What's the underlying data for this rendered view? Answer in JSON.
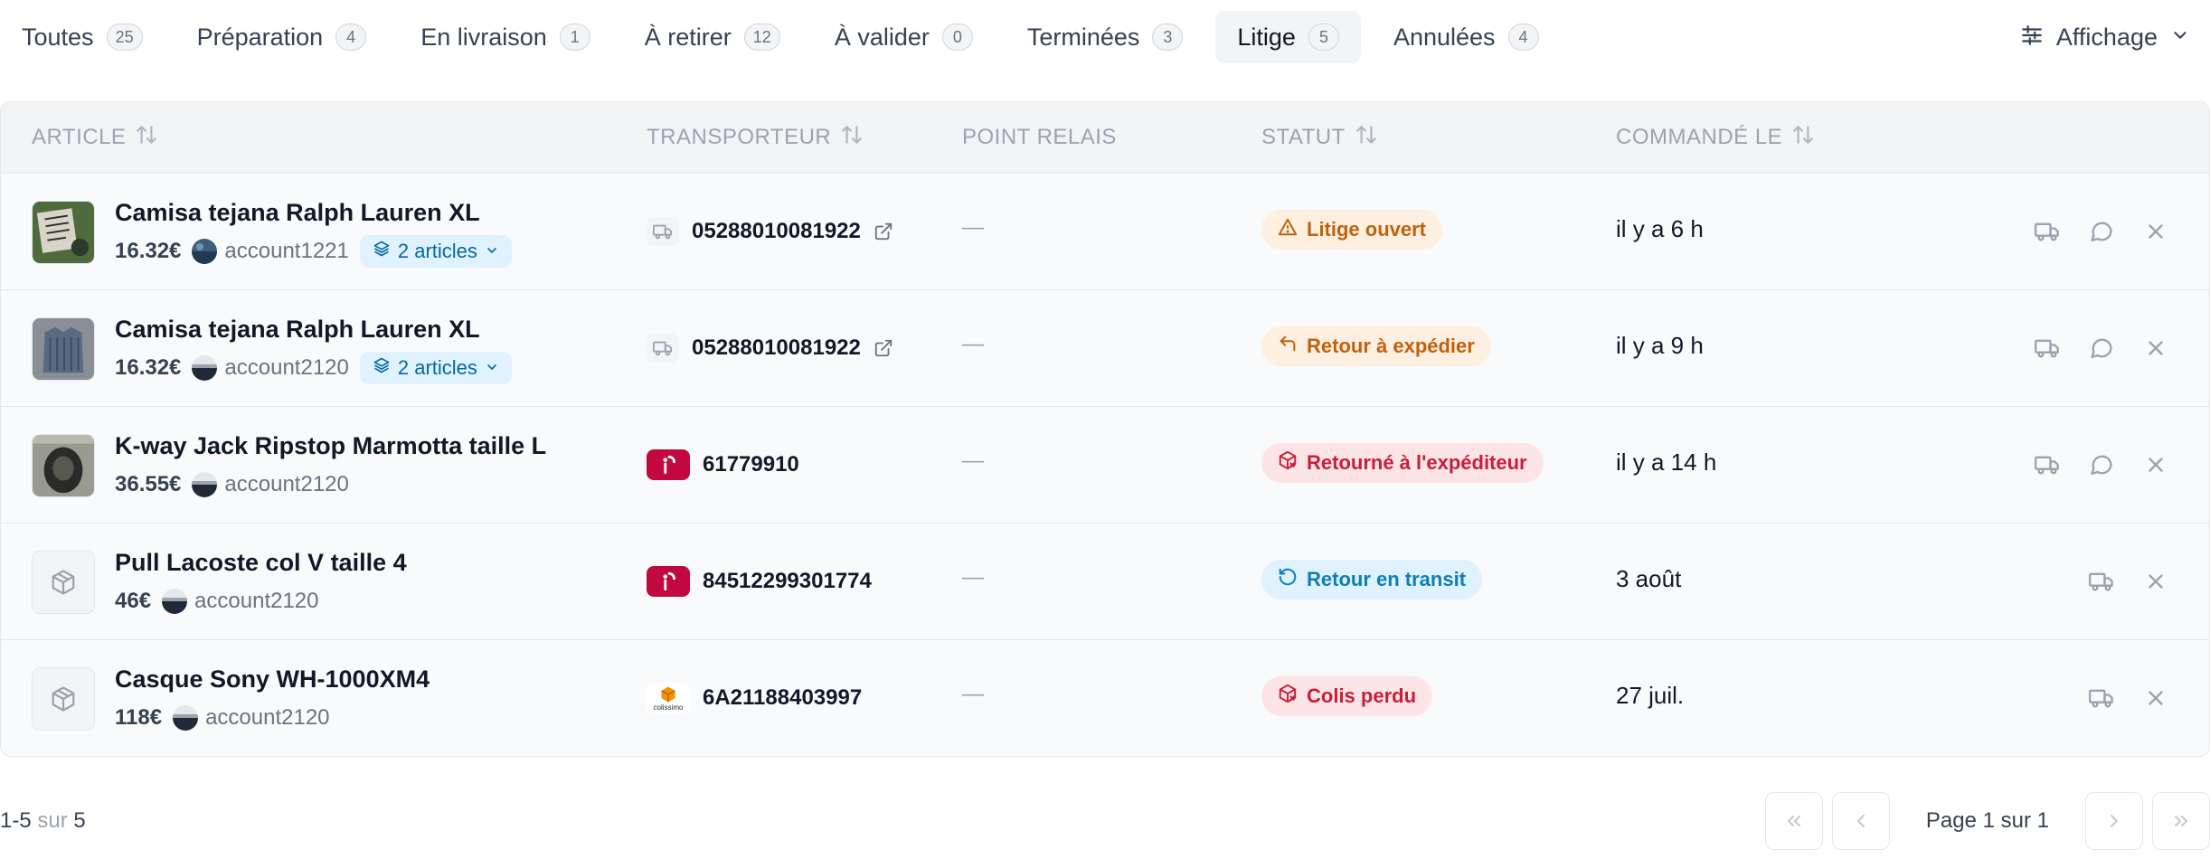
{
  "tabs": [
    {
      "label": "Toutes",
      "count": "25",
      "active": false
    },
    {
      "label": "Préparation",
      "count": "4",
      "active": false
    },
    {
      "label": "En livraison",
      "count": "1",
      "active": false
    },
    {
      "label": "À retirer",
      "count": "12",
      "active": false
    },
    {
      "label": "À valider",
      "count": "0",
      "active": false
    },
    {
      "label": "Terminées",
      "count": "3",
      "active": false
    },
    {
      "label": "Litige",
      "count": "5",
      "active": true
    },
    {
      "label": "Annulées",
      "count": "4",
      "active": false
    }
  ],
  "view_button": {
    "label": "Affichage",
    "icon": "sliders-icon"
  },
  "table": {
    "columns": {
      "article": "ARTICLE",
      "transporteur": "TRANSPORTEUR",
      "point_relais": "POINT RELAIS",
      "statut": "STATUT",
      "commande_le": "COMMANDÉ LE"
    },
    "rows": [
      {
        "title": "Camisa tejana Ralph Lauren XL",
        "price": "16.32€",
        "account": "account1221",
        "articles": "2 articles",
        "carrier": "generic",
        "tracking": "05288010081922",
        "relay": "—",
        "status": "Litige ouvert",
        "status_tone": "orange",
        "date": "il y a 6 h"
      },
      {
        "title": "Camisa tejana Ralph Lauren XL",
        "price": "16.32€",
        "account": "account2120",
        "articles": "2 articles",
        "carrier": "generic",
        "tracking": "05288010081922",
        "relay": "—",
        "status": "Retour à expédier",
        "status_tone": "orange",
        "date": "il y a 9 h"
      },
      {
        "title": "K-way Jack Ripstop Marmotta taille L",
        "price": "36.55€",
        "account": "account2120",
        "articles": "",
        "carrier": "mondial-relay",
        "tracking": "61779910",
        "relay": "—",
        "status": "Retourné à l'expéditeur",
        "status_tone": "red",
        "date": "il y a 14 h"
      },
      {
        "title": "Pull Lacoste col V taille 4",
        "price": "46€",
        "account": "account2120",
        "articles": "",
        "carrier": "mondial-relay",
        "tracking": "84512299301774",
        "relay": "—",
        "status": "Retour en transit",
        "status_tone": "blue",
        "date": "3 août"
      },
      {
        "title": "Casque Sony WH-1000XM4",
        "price": "118€",
        "account": "account2120",
        "articles": "",
        "carrier": "colissimo",
        "tracking": "6A21188403997",
        "relay": "—",
        "status": "Colis perdu",
        "status_tone": "red",
        "date": "27 juil."
      }
    ]
  },
  "carrier_logo_text": {
    "colissimo": "colissimo"
  },
  "footer": {
    "range_start": "1-5",
    "range_sep": "sur",
    "range_total": "5",
    "page_info": "Page 1 sur 1"
  },
  "colors": {
    "status_orange": "#c2610c",
    "status_red": "#c81e3a",
    "status_blue": "#0e7fb5",
    "mondial_relay": "#c1093f"
  }
}
